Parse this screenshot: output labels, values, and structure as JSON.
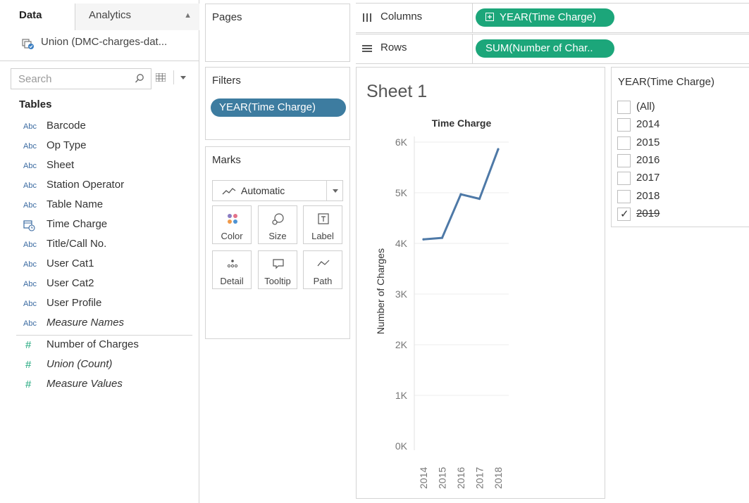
{
  "data_pane": {
    "tabs": {
      "data": "Data",
      "analytics": "Analytics"
    },
    "datasource": "Union (DMC-charges-dat...",
    "search_placeholder": "Search",
    "tables_heading": "Tables",
    "type_label": "Abc",
    "measure_symbol": "#",
    "dimensions": [
      {
        "name": "Barcode",
        "type": "string"
      },
      {
        "name": "Op Type",
        "type": "string"
      },
      {
        "name": "Sheet",
        "type": "string"
      },
      {
        "name": "Station Operator",
        "type": "string"
      },
      {
        "name": "Table Name",
        "type": "string"
      },
      {
        "name": "Time Charge",
        "type": "date"
      },
      {
        "name": "Title/Call No.",
        "type": "string"
      },
      {
        "name": "User Cat1",
        "type": "string"
      },
      {
        "name": "User Cat2",
        "type": "string"
      },
      {
        "name": "User Profile",
        "type": "string"
      },
      {
        "name": "Measure Names",
        "type": "string",
        "italic": true
      }
    ],
    "measures": [
      {
        "name": "Number of Charges",
        "italic": false
      },
      {
        "name": "Union (Count)",
        "italic": true
      },
      {
        "name": "Measure Values",
        "italic": true
      }
    ]
  },
  "pages": {
    "title": "Pages"
  },
  "filters": {
    "title": "Filters",
    "pill": "YEAR(Time Charge)"
  },
  "marks": {
    "title": "Marks",
    "type": "Automatic",
    "buttons": [
      "Color",
      "Size",
      "Label",
      "Detail",
      "Tooltip",
      "Path"
    ]
  },
  "shelves": {
    "columns": {
      "label": "Columns",
      "pill": "YEAR(Time Charge)"
    },
    "rows": {
      "label": "Rows",
      "pill": "SUM(Number of Char.."
    }
  },
  "sheet": {
    "title": "Sheet 1"
  },
  "chart_data": {
    "type": "line",
    "title": "Time Charge",
    "ylabel": "Number of Charges",
    "xlabel": "",
    "x": [
      "2014",
      "2015",
      "2016",
      "2017",
      "2018"
    ],
    "values": [
      4080,
      4110,
      4970,
      4880,
      5860
    ],
    "ylim": [
      0,
      6000
    ],
    "yticks": [
      "0K",
      "1K",
      "2K",
      "3K",
      "4K",
      "5K",
      "6K"
    ],
    "grid": true,
    "color": "#4e79a7"
  },
  "filter_card": {
    "title": "YEAR(Time Charge)",
    "items": [
      {
        "label": "(All)",
        "checked": false,
        "strike": false
      },
      {
        "label": "2014",
        "checked": false,
        "strike": false
      },
      {
        "label": "2015",
        "checked": false,
        "strike": false
      },
      {
        "label": "2016",
        "checked": false,
        "strike": false
      },
      {
        "label": "2017",
        "checked": false,
        "strike": false
      },
      {
        "label": "2018",
        "checked": false,
        "strike": false
      },
      {
        "label": "2019",
        "checked": true,
        "strike": true
      }
    ]
  },
  "colors": {
    "dimension_pill": "#3d7ca0",
    "measure_pill": "#1ca67a",
    "line": "#4e79a7"
  }
}
